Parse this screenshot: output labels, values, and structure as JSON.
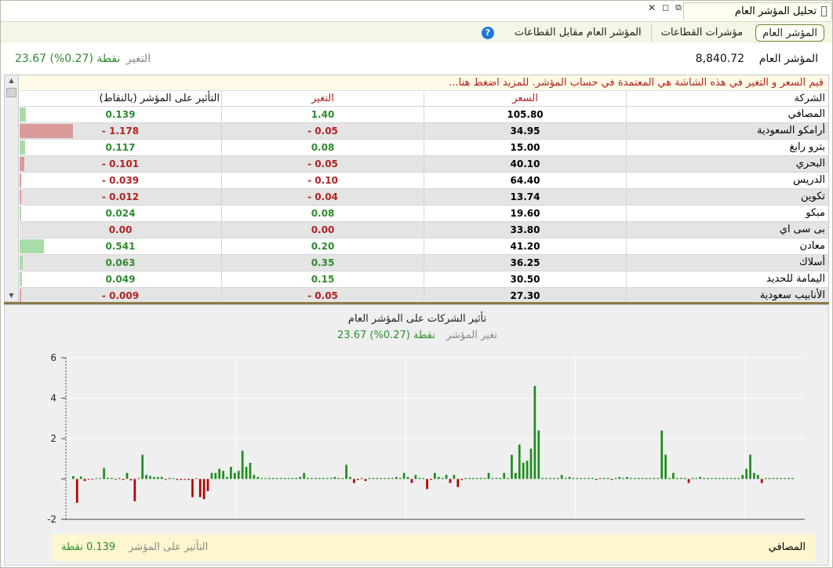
{
  "window": {
    "title": "تحليل المؤشر العام",
    "controls": [
      "✕",
      "◻",
      "⧉"
    ]
  },
  "tabs": [
    {
      "label": "المؤشر العام",
      "active": true
    },
    {
      "label": "مؤشرات القطاعات",
      "active": false
    },
    {
      "label": "المؤشر العام مقابل القطاعات",
      "active": false
    }
  ],
  "help_icon": "help-icon",
  "summary": {
    "index_label": "المؤشر العام",
    "index_value": "8,840.72",
    "change_label": "التغير",
    "change_value": "23.67 نقطة (0.27%)"
  },
  "notice": "قيم السعر و التغير في هذه الشاشة هي المعتمدة في حساب المؤشر. للمزيد اضغط هنا...",
  "table": {
    "headers": {
      "company": "الشركة",
      "price": "السعر",
      "change": "التغير",
      "impact": "التأثير على المؤشر (بالنقاط)"
    },
    "rows": [
      {
        "company": "المصافي",
        "price": "105.80",
        "change": "1.40",
        "impact": "0.139",
        "impact_num": 0.139
      },
      {
        "company": "أرامكو السعودية",
        "price": "34.95",
        "change": "0.05 -",
        "impact": "1.178 -",
        "impact_num": -1.178
      },
      {
        "company": "بترو رابغ",
        "price": "15.00",
        "change": "0.08",
        "impact": "0.117",
        "impact_num": 0.117
      },
      {
        "company": "البحري",
        "price": "40.10",
        "change": "0.05 -",
        "impact": "0.101 -",
        "impact_num": -0.101
      },
      {
        "company": "الدريس",
        "price": "64.40",
        "change": "0.10 -",
        "impact": "0.039 -",
        "impact_num": -0.039
      },
      {
        "company": "تكوين",
        "price": "13.74",
        "change": "0.04 -",
        "impact": "0.012 -",
        "impact_num": -0.012
      },
      {
        "company": "مبكو",
        "price": "19.60",
        "change": "0.08",
        "impact": "0.024",
        "impact_num": 0.024
      },
      {
        "company": "بى سى اي",
        "price": "33.80",
        "change": "0.00",
        "impact": "0.00",
        "impact_num": 0
      },
      {
        "company": "معادن",
        "price": "41.20",
        "change": "0.20",
        "impact": "0.541",
        "impact_num": 0.541
      },
      {
        "company": "أسلاك",
        "price": "36.25",
        "change": "0.35",
        "impact": "0.063",
        "impact_num": 0.063
      },
      {
        "company": "اليمامة للحديد",
        "price": "30.50",
        "change": "0.15",
        "impact": "0.049",
        "impact_num": 0.049
      },
      {
        "company": "الأنابيب سعودية",
        "price": "27.30",
        "change": "0.05 -",
        "impact": "0.009 -",
        "impact_num": -0.009
      }
    ]
  },
  "chart_title": "تأثير الشركات على المؤشر العام",
  "chart_subtitle_label": "تغير المؤشر",
  "chart_subtitle_value": "23.67 نقطة (0.27%)",
  "chart_data": {
    "type": "bar",
    "y_ticks": [
      "6",
      "4",
      "2",
      "-2"
    ],
    "ylim": [
      -2,
      6
    ],
    "grid": true,
    "colors": {
      "positive": "#1e8c1e",
      "negative": "#b20000"
    },
    "values": [
      0.139,
      -1.178,
      0.117,
      -0.101,
      -0.039,
      -0.012,
      0.024,
      0,
      0.541,
      0.063,
      0.049,
      -0.009,
      0.05,
      -0.05,
      0.3,
      -0.07,
      -1.1,
      0.02,
      1.2,
      0.2,
      0.15,
      0.1,
      0.1,
      0.1,
      -0.02,
      0.05,
      0.02,
      -0.05,
      -0.05,
      -0.04,
      -0.05,
      -0.9,
      0.02,
      -0.9,
      -1.0,
      -0.6,
      0.3,
      0.3,
      0.5,
      0.4,
      0.1,
      0.6,
      0.3,
      0.4,
      1.4,
      0.6,
      0.8,
      0.2,
      0.1,
      0.02,
      0.02,
      0.05,
      0.05,
      0.05,
      0.05,
      0.05,
      0.05,
      0.05,
      0.05,
      0.1,
      0.3,
      0.05,
      0.05,
      0.05,
      0.05,
      0.05,
      0.05,
      0.05,
      0.1,
      0.05,
      0.05,
      0.7,
      0.1,
      -0.2,
      -0.05,
      0.05,
      -0.1,
      0.05,
      0.05,
      0.05,
      0.05,
      0.05,
      0.05,
      0.05,
      0.1,
      0.05,
      0.3,
      0.1,
      -0.2,
      0.2,
      0.05,
      0.05,
      -0.5,
      -0.05,
      0.3,
      0.1,
      0.05,
      0.2,
      -0.2,
      0.2,
      -0.4,
      -0.05,
      0.05,
      0.05,
      0.05,
      0.05,
      0.05,
      0.05,
      0.3,
      0.05,
      0.05,
      0.05,
      0.3,
      0.05,
      1.2,
      0.3,
      1.7,
      0.8,
      0.9,
      1.5,
      4.6,
      2.4,
      0.05,
      0.05,
      0.05,
      0.05,
      0.05,
      0.2,
      0.05,
      0.1,
      0.05,
      0.05,
      0.05,
      0.05,
      0.05,
      0.05,
      -0.05,
      0.05,
      0.05,
      0.05,
      -0.05,
      0.05,
      0.1,
      0.05,
      0.1,
      0.05,
      0.05,
      0.05,
      0.05,
      0.05,
      0.05,
      0.05,
      0.05,
      2.4,
      1.2,
      0.05,
      0.3,
      0.05,
      0.05,
      0.05,
      -0.2,
      0.05,
      0.05,
      0.1,
      0.05,
      0.05,
      0.05,
      0.05,
      0.05,
      0.05,
      0.05,
      0.05,
      0.05,
      0.05,
      0.2,
      0.5,
      1.2,
      0.3,
      0.2,
      -0.2,
      0.05,
      0.05,
      0.05,
      0.05,
      0.05,
      0.05,
      0.05,
      0.05
    ]
  },
  "footer": {
    "company": "المصافي",
    "label": "التأثير على المؤشر",
    "value": "0.139 نقطة"
  }
}
